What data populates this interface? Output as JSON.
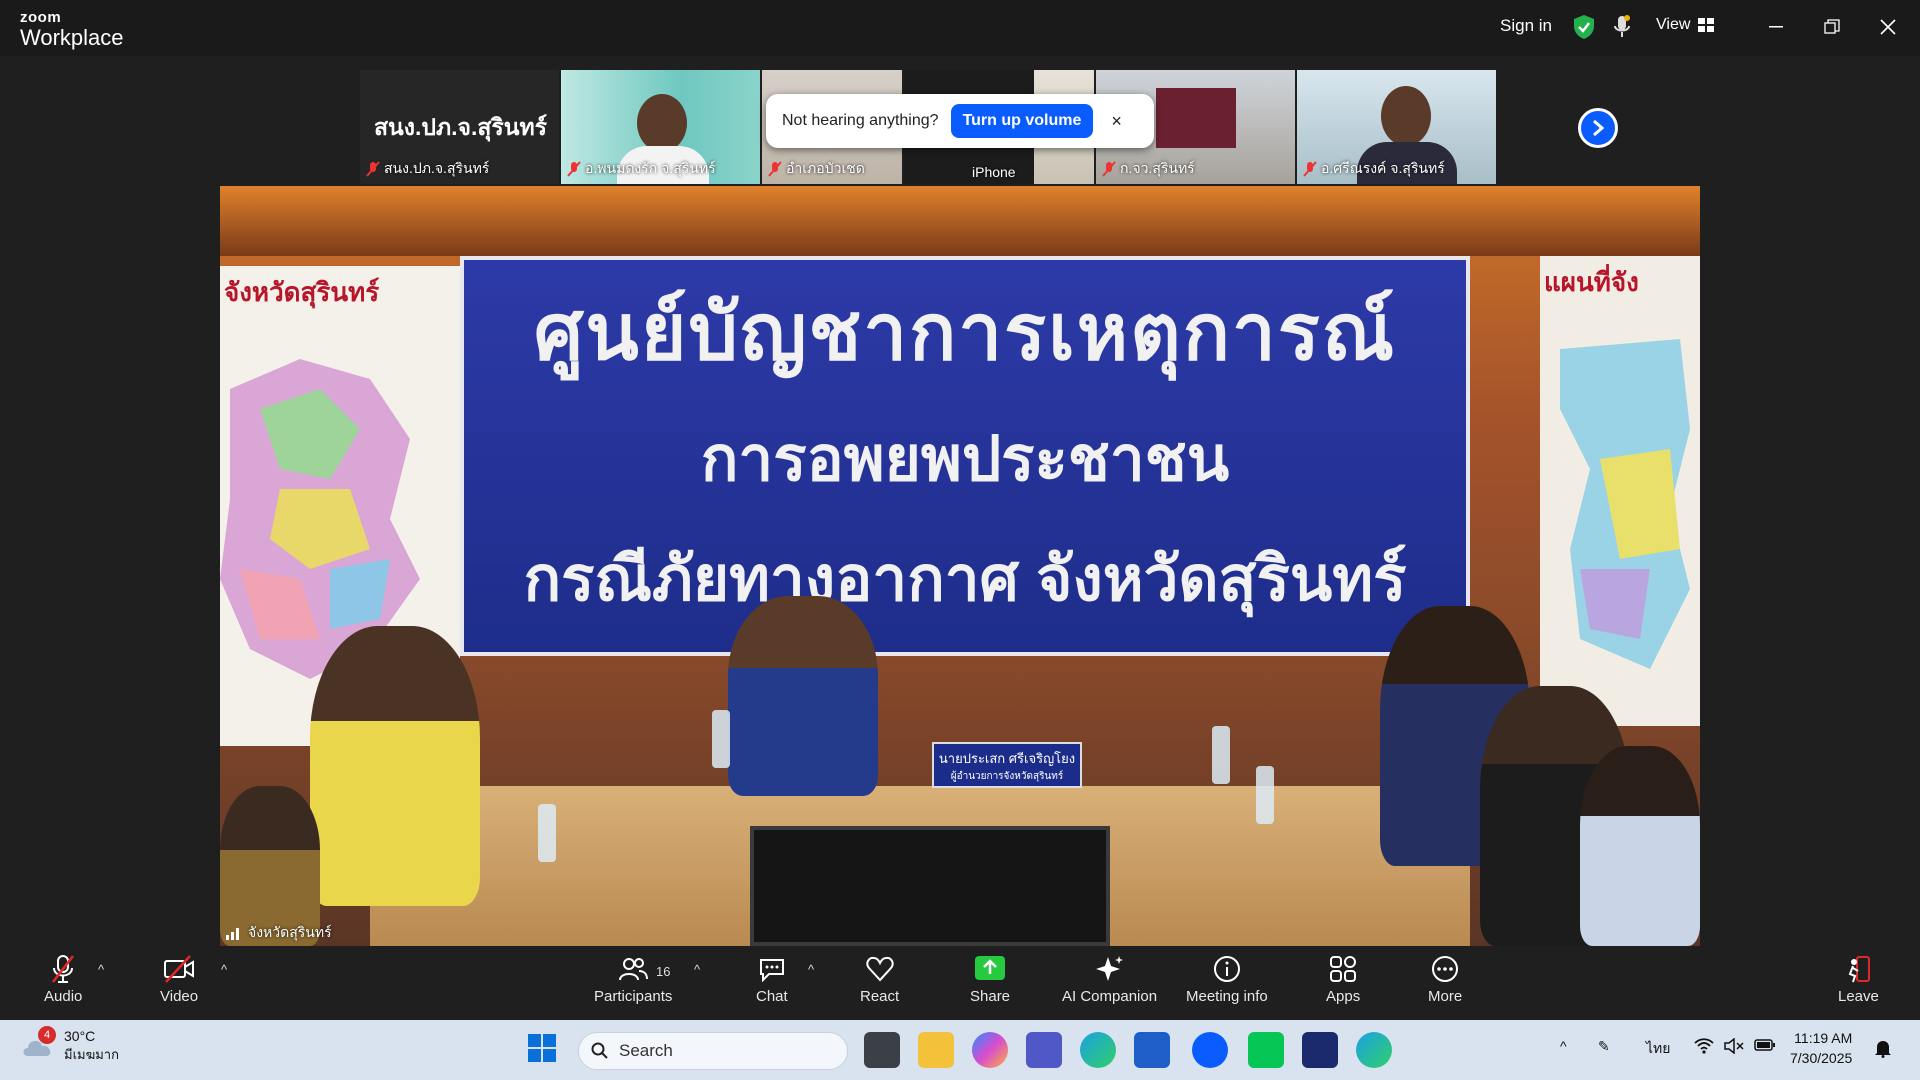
{
  "app": {
    "brand_top": "zoom",
    "brand_bottom": "Workplace"
  },
  "titlebar": {
    "signin": "Sign in",
    "view": "View"
  },
  "strip": {
    "tiles": [
      {
        "name": "สนง.ปภ.จ.สุรินทร์",
        "big": "สนง.ปภ.จ.สุรินทร์"
      },
      {
        "name": "อ.พนมดงรัก จ.สุรินทร์"
      },
      {
        "name": "อำเภอบัวเชด"
      },
      {
        "name": "iPhone"
      },
      {
        "name": "ก.จว.สุรินทร์"
      },
      {
        "name": "อ.ศรีณรงค์ จ.สุรินทร์"
      }
    ]
  },
  "toast": {
    "message": "Not hearing anything?",
    "action": "Turn up volume",
    "close": "×"
  },
  "main": {
    "banner_line1": "ศูนย์บัญชาการเหตุการณ์",
    "banner_line2": "การอพยพประชาชน",
    "banner_line3": "กรณีภัยทางอากาศ จังหวัดสุรินทร์",
    "map_left_title": "จังหวัดสุรินทร์",
    "map_right_title": "แผนที่จัง",
    "nameplate": "นายประเสก ศรีเจริญโยง",
    "nameplate_sub": "ผู้อำนวยการจังหวัดสุรินทร์",
    "speaker": "จังหวัดสุรินทร์"
  },
  "toolbar": {
    "audio": "Audio",
    "video": "Video",
    "participants": "Participants",
    "participants_count": "16",
    "chat": "Chat",
    "react": "React",
    "share": "Share",
    "ai": "AI Companion",
    "info": "Meeting info",
    "apps": "Apps",
    "more": "More",
    "leave": "Leave"
  },
  "taskbar": {
    "temp": "30°C",
    "weather": "มีเมฆมาก",
    "weather_badge": "4",
    "search": "Search",
    "lang": "ไทย",
    "time": "11:19 AM",
    "date": "7/30/2025"
  },
  "colors": {
    "accent": "#0b5cff",
    "share_green": "#27c93f",
    "leave_red": "#e02828"
  }
}
